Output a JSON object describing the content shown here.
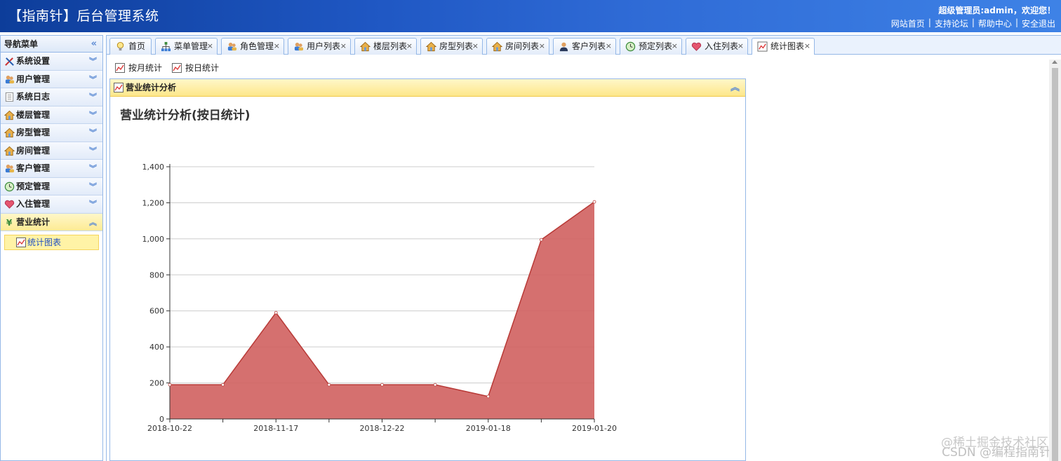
{
  "header": {
    "title": "【指南针】后台管理系统",
    "user_greeting": "超级管理员:admin，欢迎您！",
    "links": [
      "网站首页",
      "支持论坛",
      "帮助中心",
      "安全退出"
    ]
  },
  "sidebar": {
    "title": "导航菜单",
    "items": [
      {
        "label": "系统设置",
        "icon": "tools-icon"
      },
      {
        "label": "用户管理",
        "icon": "users-icon"
      },
      {
        "label": "系统日志",
        "icon": "log-icon"
      },
      {
        "label": "楼层管理",
        "icon": "house-icon"
      },
      {
        "label": "房型管理",
        "icon": "house-icon"
      },
      {
        "label": "房间管理",
        "icon": "house-icon"
      },
      {
        "label": "客户管理",
        "icon": "users-icon"
      },
      {
        "label": "预定管理",
        "icon": "clock-icon"
      },
      {
        "label": "入住管理",
        "icon": "heart-icon"
      },
      {
        "label": "营业统计",
        "icon": "yen-icon",
        "active": true
      }
    ],
    "sub_items": [
      {
        "label": "统计图表",
        "icon": "chart-icon"
      }
    ]
  },
  "tabs": [
    {
      "label": "首页",
      "icon": "bulb-icon",
      "closable": false
    },
    {
      "label": "菜单管理",
      "icon": "tree-icon",
      "closable": true
    },
    {
      "label": "角色管理",
      "icon": "users-icon",
      "closable": true
    },
    {
      "label": "用户列表",
      "icon": "users-icon",
      "closable": true
    },
    {
      "label": "楼层列表",
      "icon": "house-icon",
      "closable": true
    },
    {
      "label": "房型列表",
      "icon": "house-icon",
      "closable": true
    },
    {
      "label": "房间列表",
      "icon": "house-icon",
      "closable": true
    },
    {
      "label": "客户列表",
      "icon": "person-icon",
      "closable": true
    },
    {
      "label": "预定列表",
      "icon": "clock-icon",
      "closable": true
    },
    {
      "label": "入住列表",
      "icon": "heart-icon",
      "closable": true
    },
    {
      "label": "统计图表",
      "icon": "chart-icon",
      "closable": true,
      "active": true
    }
  ],
  "toolbar": {
    "monthly_label": "按月统计",
    "daily_label": "按日统计"
  },
  "panel": {
    "title": "营业统计分析"
  },
  "chart_data": {
    "type": "area",
    "title": "营业统计分析(按日统计)",
    "x": [
      "2018-10-22",
      "",
      "2018-11-17",
      "",
      "2018-12-22",
      "",
      "2019-01-18",
      "",
      "2019-01-20"
    ],
    "x_tick_labels": [
      "2018-10-22",
      "2018-11-17",
      "2018-12-22",
      "2019-01-18",
      "2019-01-20"
    ],
    "values": [
      190,
      190,
      590,
      190,
      190,
      190,
      125,
      995,
      1205
    ],
    "ylim": [
      0,
      1400
    ],
    "yticks": [
      "0",
      "200",
      "400",
      "600",
      "800",
      "1,000",
      "1,200",
      "1,400"
    ],
    "grid": true,
    "fill_color": "#d0615f",
    "line_color": "#b83a37"
  },
  "watermark": {
    "line1": "@稀土掘金技术社区",
    "line2": "CSDN @编程指南针"
  }
}
